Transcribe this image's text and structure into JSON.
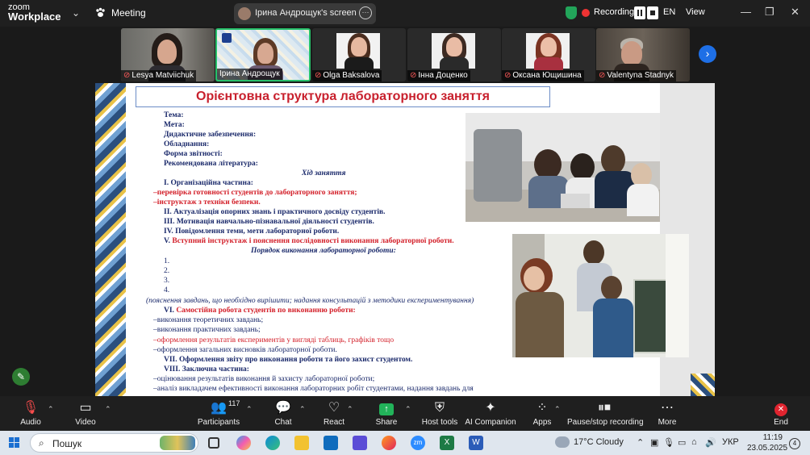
{
  "app": {
    "logo_line1": "zoom",
    "logo_line2": "Workplace",
    "meeting_label": "Meeting"
  },
  "share": {
    "title": "Ірина  Андрощук's screen"
  },
  "recording": {
    "label": "Recording..."
  },
  "language": "EN",
  "view_label": "View",
  "participants_strip": [
    {
      "name": "Lesya Matviichuk"
    },
    {
      "name": "Ірина  Андрощук"
    },
    {
      "name": "Olga Baksalova"
    },
    {
      "name": "Інна Доценко"
    },
    {
      "name": "Оксана Ющишина"
    },
    {
      "name": "Valentyna Stadnyk"
    }
  ],
  "slide": {
    "title": "Орієнтовна структура лабораторного заняття",
    "lines": [
      "Тема:",
      "Мета:",
      "Дидактичне забезпечення:",
      "Обладнання:",
      "Форма звітності:",
      "Рекомендована література:",
      "Хід заняття",
      "I. Організаційна частина:",
      "–перевірка готовності студентів до лабораторного заняття;",
      "–інструктаж з техніки безпеки.",
      "II. Актуалізація опорних знань і практичного досвіду студентів.",
      "III. Мотивація навчально-пізнавальної діяльності студентів.",
      "IV. Повідомлення теми, мети лабораторної роботи.",
      "V.",
      "Вступний інструктаж і пояснення послідовності виконання лабораторної роботи.",
      "Порядок виконання лабораторної роботи:",
      "1.",
      "2.",
      "3.",
      "4.",
      "(пояснення завдань, що необхідно вирішити; надання консультацій з методики експериментування)",
      "VI.",
      "Самостійна робота студентів по виконанню роботи:",
      "–виконання теоретичних завдань;",
      "–виконання практичних завдань;",
      "–оформлення результатів експериментів у вигляді таблиць, графіків тощо",
      "–оформлення загальних висновків лабораторної роботи.",
      "VII. Оформлення звіту про виконання роботи та його захист студентом.",
      "VIII. Заключна частина:",
      "–оцінювання результатів виконання й захисту лабораторної роботи;",
      "–аналіз викладачем ефективності виконання лабораторних робіт студентами, надання завдань для"
    ]
  },
  "toolbar": {
    "audio": "Audio",
    "video": "Video",
    "participants": "Participants",
    "participants_count": "117",
    "chat": "Chat",
    "react": "React",
    "share": "Share",
    "host_tools": "Host tools",
    "ai_companion": "AI Companion",
    "apps": "Apps",
    "pause_stop": "Pause/stop recording",
    "more": "More",
    "end": "End"
  },
  "taskbar": {
    "search_placeholder": "Пошук",
    "weather": "17°C  Cloudy",
    "lang": "УКР",
    "time": "11:19",
    "date": "23.05.2025",
    "notif_count": "4"
  },
  "colors": {
    "accent_blue": "#1e6fe6",
    "record_red": "#e33333",
    "share_green": "#22a55a",
    "slide_title_red": "#c8202d",
    "slide_navy": "#1b2a6b"
  }
}
